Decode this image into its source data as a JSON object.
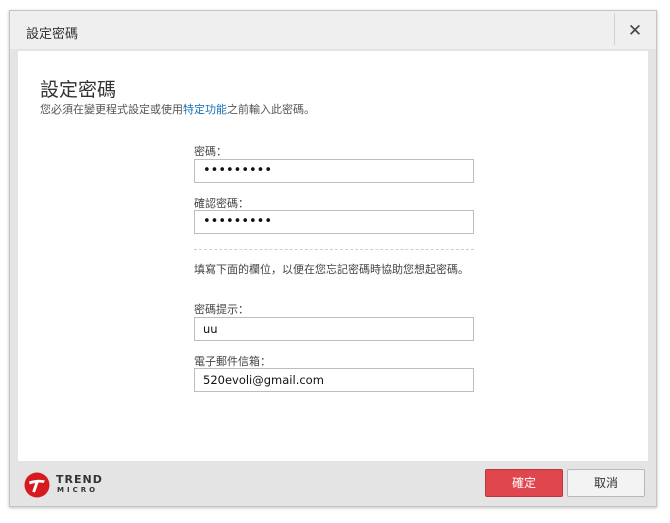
{
  "window": {
    "title": "設定密碼",
    "close_glyph": "✕"
  },
  "main": {
    "heading": "設定密碼",
    "subtitle_before": "您必須在變更程式設定或使用",
    "subtitle_link": "特定功能",
    "subtitle_after": "之前輸入此密碼。"
  },
  "form": {
    "password_label": "密碼：",
    "password_value": "•••••••••",
    "confirm_label": "確認密碼：",
    "confirm_value": "•••••••••",
    "hint_instructions": "填寫下面的欄位，以便在您忘記密碼時協助您想起密碼。",
    "hint_label": "密碼提示：",
    "hint_value": "uu",
    "email_label": "電子郵件信箱：",
    "email_value": "520evoli@gmail.com"
  },
  "footer": {
    "logo_main": "TREND",
    "logo_sub": "MICRO",
    "ok_label": "確定",
    "cancel_label": "取消"
  },
  "colors": {
    "brand_red": "#e0464e",
    "link_blue": "#1a6fb3"
  },
  "icons": {
    "close": "close-icon",
    "logo": "trend-micro-logo-icon"
  }
}
